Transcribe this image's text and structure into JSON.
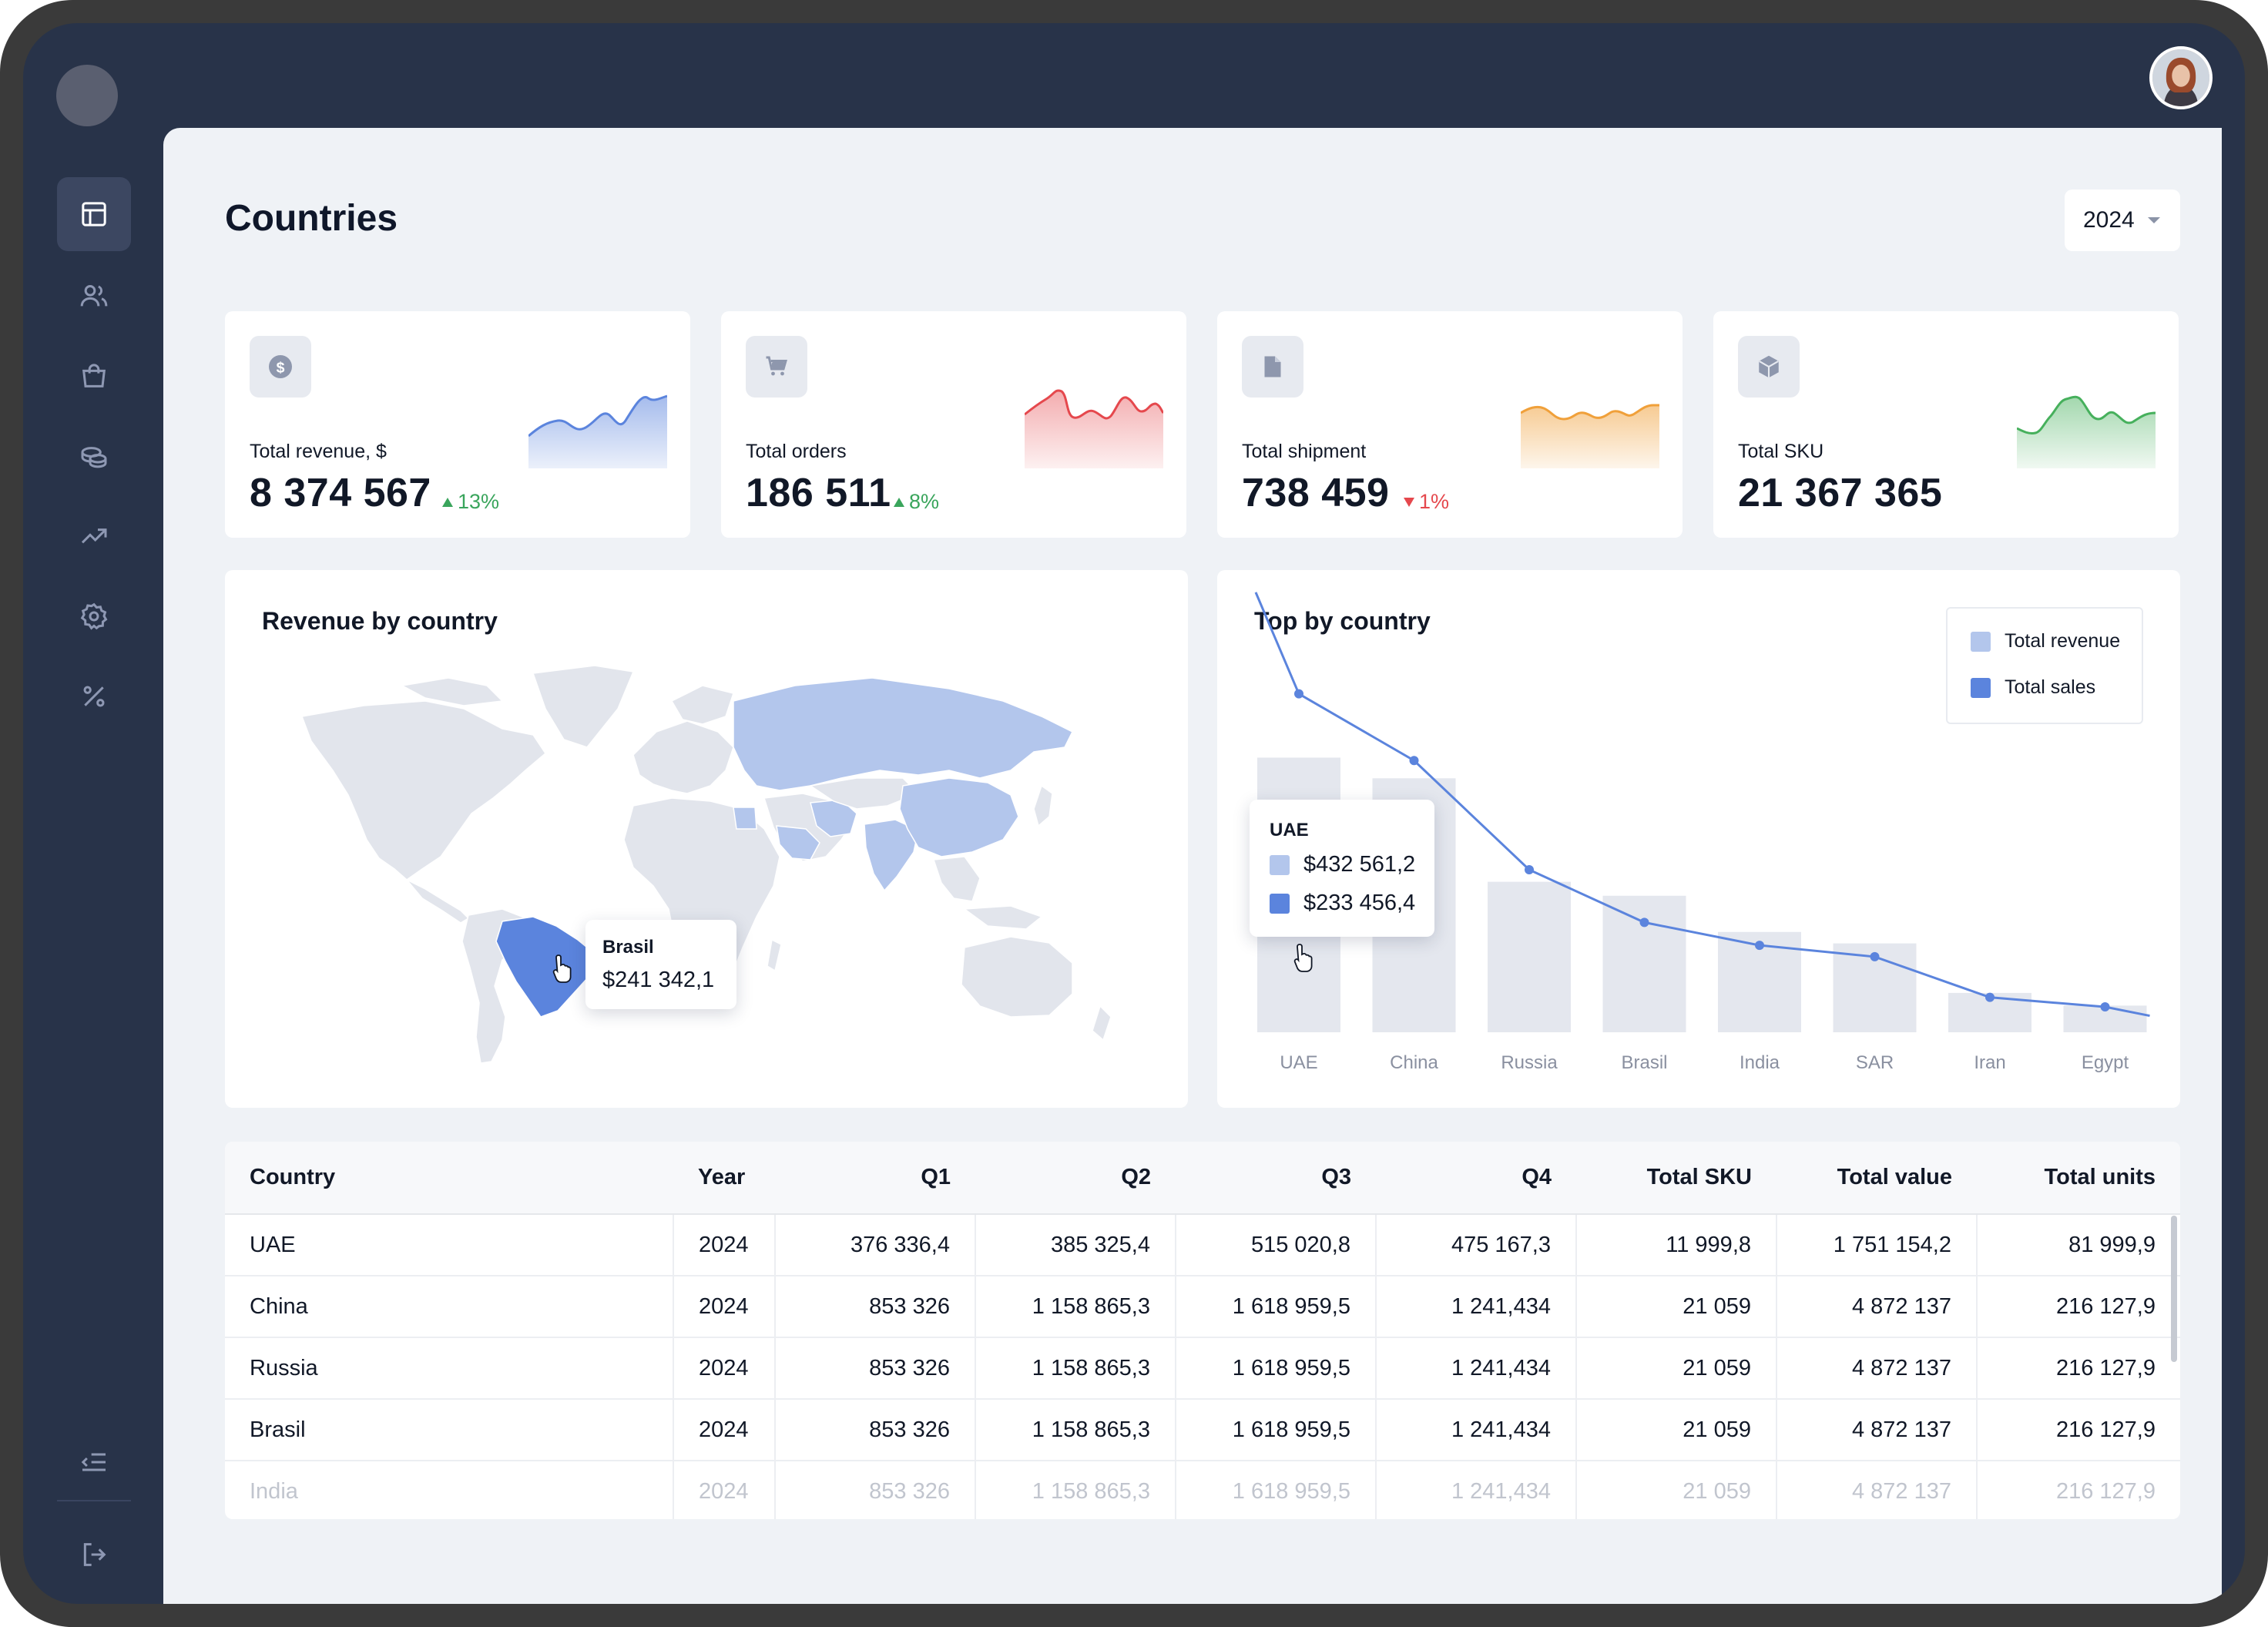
{
  "page": {
    "title": "Countries",
    "year_selected": "2024"
  },
  "sidebar": {
    "items": [
      {
        "name": "dashboard",
        "icon": "table-icon",
        "active": true
      },
      {
        "name": "users",
        "icon": "users-icon"
      },
      {
        "name": "shop",
        "icon": "shopping-bag-icon"
      },
      {
        "name": "finance",
        "icon": "coins-icon"
      },
      {
        "name": "analytics",
        "icon": "trending-up-icon"
      },
      {
        "name": "settings",
        "icon": "gear-icon"
      },
      {
        "name": "discounts",
        "icon": "percent-icon"
      }
    ],
    "bottom": [
      {
        "name": "collapse",
        "icon": "collapse-menu-icon"
      },
      {
        "name": "logout",
        "icon": "logout-icon"
      }
    ]
  },
  "kpis": [
    {
      "label": "Total revenue, $",
      "value": "8 374 567",
      "change": "13%",
      "direction": "up",
      "icon": "dollar-icon",
      "color": "#5b84dd"
    },
    {
      "label": "Total orders",
      "value": "186 511",
      "change": "8%",
      "direction": "up",
      "icon": "cart-icon",
      "color": "#e5484d"
    },
    {
      "label": "Total shipment",
      "value": "738 459",
      "change": "1%",
      "direction": "down",
      "icon": "document-icon",
      "color": "#f0a03a"
    },
    {
      "label": "Total SKU",
      "value": "21 367 365",
      "icon": "box-icon",
      "color": "#46b05c"
    }
  ],
  "map": {
    "title": "Revenue by country",
    "tooltip": {
      "country": "Brasil",
      "value": "$241 342,1"
    },
    "highlight_colors": {
      "selected": "#5b84dd",
      "active": "#b3c6ec",
      "other": "#e2e5ec"
    }
  },
  "chart_data": {
    "type": "bar",
    "title": "Top by country",
    "categories": [
      "UAE",
      "China",
      "Russia",
      "Brasil",
      "India",
      "SAR",
      "Iran",
      "Egypt"
    ],
    "series": [
      {
        "name": "Total revenue",
        "type": "bar",
        "color": "#e4e7ee",
        "values": [
          432561.2,
          400000,
          237000,
          215000,
          158000,
          140000,
          62000,
          42000
        ]
      },
      {
        "name": "Total sales",
        "type": "line",
        "color": "#5b84dd",
        "values": [
          533000,
          428000,
          256000,
          173000,
          137000,
          119000,
          55000,
          40000
        ]
      }
    ],
    "legend": "top-right",
    "tooltip": {
      "category": "UAE",
      "revenue": "$432 561,2",
      "sales": "$233 456,4"
    },
    "ylim": [
      0,
      660000
    ]
  },
  "table": {
    "columns": [
      "Country",
      "Year",
      "Q1",
      "Q2",
      "Q3",
      "Q4",
      "Total SKU",
      "Total value",
      "Total units"
    ],
    "rows": [
      [
        "UAE",
        "2024",
        "376 336,4",
        "385 325,4",
        "515 020,8",
        "475 167,3",
        "11 999,8",
        "1 751 154,2",
        "81 999,9"
      ],
      [
        "China",
        "2024",
        "853 326",
        "1 158 865,3",
        "1 618 959,5",
        "1 241,434",
        "21 059",
        "4 872 137",
        "216 127,9"
      ],
      [
        "Russia",
        "2024",
        "853 326",
        "1 158 865,3",
        "1 618 959,5",
        "1 241,434",
        "21 059",
        "4 872 137",
        "216 127,9"
      ],
      [
        "Brasil",
        "2024",
        "853 326",
        "1 158 865,3",
        "1 618 959,5",
        "1 241,434",
        "21 059",
        "4 872 137",
        "216 127,9"
      ],
      [
        "India",
        "2024",
        "853 326",
        "1 158 865,3",
        "1 618 959,5",
        "1 241,434",
        "21 059",
        "4 872 137",
        "216 127,9"
      ]
    ]
  }
}
